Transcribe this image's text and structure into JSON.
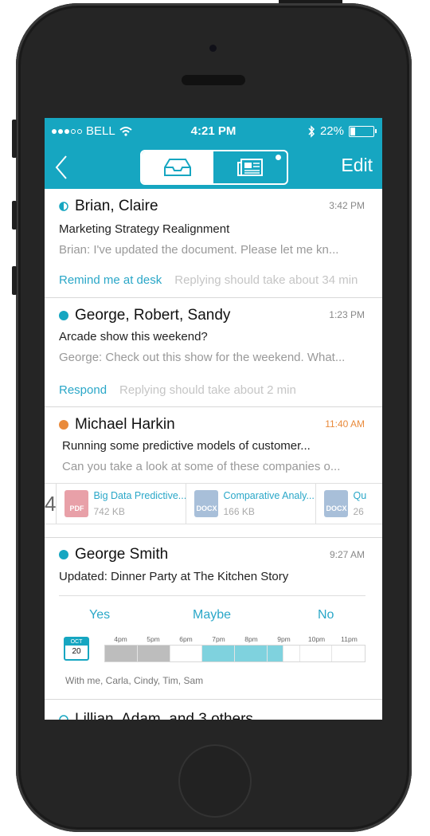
{
  "status_bar": {
    "carrier": "BELL",
    "time": "4:21 PM",
    "battery": "22%"
  },
  "nav": {
    "edit_label": "Edit",
    "back_icon": "chevron-left-icon",
    "tabs": [
      {
        "icon": "inbox-icon",
        "active": true
      },
      {
        "icon": "newspaper-icon",
        "active": false
      }
    ]
  },
  "messages": [
    {
      "name": "Brian, Claire",
      "time": "3:42 PM",
      "subject": "Marketing Strategy Realignment",
      "preview": "Brian: I've updated the document. Please let me kn...",
      "action": "Remind me at desk",
      "hint": "Replying should take about 34 min",
      "indicator": "half-circle"
    },
    {
      "name": "George, Robert, Sandy",
      "time": "1:23 PM",
      "subject": "Arcade show this weekend?",
      "preview": "George: Check out this show for the weekend. What...",
      "action": "Respond",
      "hint": "Replying should take about 2 min",
      "indicator": "dot-blue"
    },
    {
      "name": "Michael Harkin",
      "time": "11:40 AM",
      "subject": "Running some predictive models of customer...",
      "preview": "Can you take a look at some of these companies o...",
      "attachment_count": "4",
      "attachments": [
        {
          "type": "PDF",
          "name": "Big Data Predictive...",
          "size": "742 KB"
        },
        {
          "type": "DOCX",
          "name": "Comparative Analy...",
          "size": "166 KB"
        },
        {
          "type": "DOCX",
          "name": "Qu",
          "size": "26"
        }
      ],
      "indicator": "dot-orange"
    },
    {
      "name": "George Smith",
      "time": "9:27 AM",
      "subject": "Updated: Dinner Party at The Kitchen Story",
      "rsvp": [
        "Yes",
        "Maybe",
        "No"
      ],
      "calendar": {
        "month": "OCT",
        "day": "20"
      },
      "timeline": [
        "4pm",
        "5pm",
        "6pm",
        "7pm",
        "8pm",
        "9pm",
        "10pm",
        "11pm"
      ],
      "attendees": "With me, Carla, Cindy, Tim, Sam",
      "indicator": "dot-blue"
    },
    {
      "name": "Lillian, Adam, and 3 others",
      "time": "",
      "indicator": "half-circle"
    }
  ],
  "colors": {
    "accent": "#16a6c1",
    "orange": "#e98a3b",
    "link": "#2aa7c8",
    "busy": "#bdbdbd",
    "event": "#7fd2de"
  }
}
